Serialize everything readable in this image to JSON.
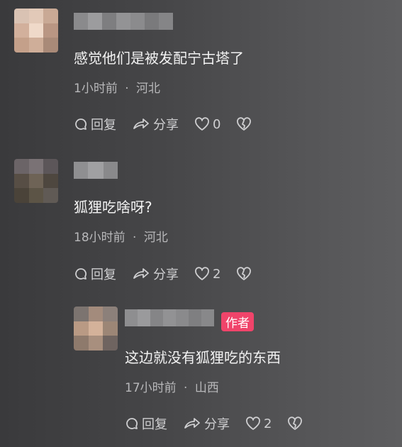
{
  "comments": [
    {
      "text": "感觉他们是被发配宁古塔了",
      "time": "1小时前",
      "location": "河北",
      "reply_label": "回复",
      "share_label": "分享",
      "likes": "0"
    },
    {
      "text": "狐狸吃啥呀?",
      "time": "18小时前",
      "location": "河北",
      "reply_label": "回复",
      "share_label": "分享",
      "likes": "2"
    },
    {
      "text": "这边就没有狐狸吃的东西",
      "time": "17小时前",
      "location": "山西",
      "badge": "作者",
      "reply_label": "回复",
      "share_label": "分享",
      "likes": "2"
    }
  ],
  "separator": "·",
  "icons": {
    "reply": "reply-bubble-icon",
    "share": "share-arrow-icon",
    "like": "heart-icon",
    "dislike": "broken-heart-icon"
  }
}
